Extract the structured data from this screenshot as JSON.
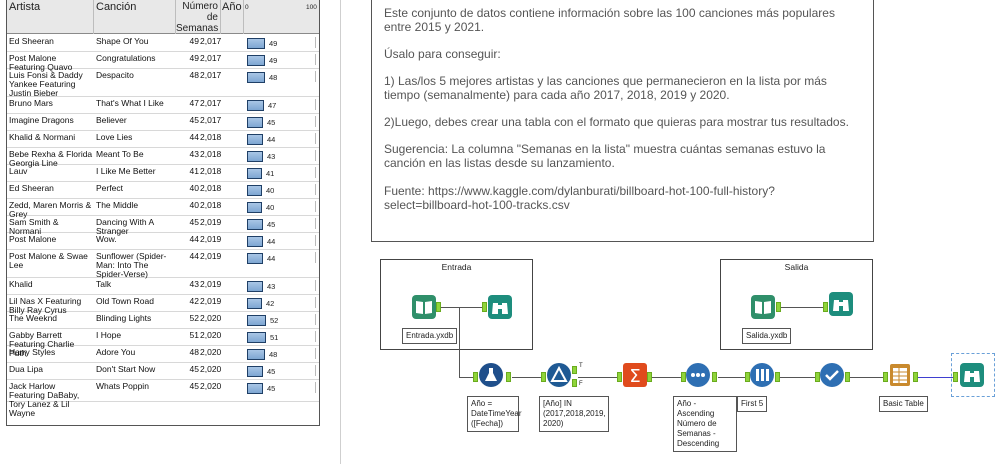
{
  "table": {
    "headers": {
      "artist": "Artista",
      "song": "Canción",
      "weeks": "Número de Semanas",
      "year": "Año",
      "axis_min": "0",
      "axis_max": "100"
    },
    "rows": [
      {
        "artist": "Ed Sheeran",
        "song": "Shape Of You",
        "weeks": "49",
        "year": "2,017",
        "bar": 49
      },
      {
        "artist": "Post Malone Featuring Quavo",
        "song": "Congratulations",
        "weeks": "49",
        "year": "2,017",
        "bar": 49
      },
      {
        "artist": "Luis Fonsi & Daddy Yankee Featuring Justin Bieber",
        "song": "Despacito",
        "weeks": "48",
        "year": "2,017",
        "bar": 48
      },
      {
        "artist": "Bruno Mars",
        "song": "That's What I Like",
        "weeks": "47",
        "year": "2,017",
        "bar": 47
      },
      {
        "artist": "Imagine Dragons",
        "song": "Believer",
        "weeks": "45",
        "year": "2,017",
        "bar": 45
      },
      {
        "artist": "Khalid & Normani",
        "song": "Love Lies",
        "weeks": "44",
        "year": "2,018",
        "bar": 44
      },
      {
        "artist": "Bebe Rexha & Florida Georgia Line",
        "song": "Meant To Be",
        "weeks": "43",
        "year": "2,018",
        "bar": 43
      },
      {
        "artist": "Lauv",
        "song": "I Like Me Better",
        "weeks": "41",
        "year": "2,018",
        "bar": 41
      },
      {
        "artist": "Ed Sheeran",
        "song": "Perfect",
        "weeks": "40",
        "year": "2,018",
        "bar": 40
      },
      {
        "artist": "Zedd, Maren Morris & Grey",
        "song": "The Middle",
        "weeks": "40",
        "year": "2,018",
        "bar": 40
      },
      {
        "artist": "Sam Smith & Normani",
        "song": "Dancing With A Stranger",
        "weeks": "45",
        "year": "2,019",
        "bar": 45
      },
      {
        "artist": "Post Malone",
        "song": "Wow.",
        "weeks": "44",
        "year": "2,019",
        "bar": 44
      },
      {
        "artist": "Post Malone & Swae Lee",
        "song": "Sunflower (Spider-Man: Into The Spider-Verse)",
        "weeks": "44",
        "year": "2,019",
        "bar": 44
      },
      {
        "artist": "Khalid",
        "song": "Talk",
        "weeks": "43",
        "year": "2,019",
        "bar": 43
      },
      {
        "artist": "Lil Nas X Featuring Billy Ray Cyrus",
        "song": "Old Town Road",
        "weeks": "42",
        "year": "2,019",
        "bar": 42
      },
      {
        "artist": "The Weeknd",
        "song": "Blinding Lights",
        "weeks": "52",
        "year": "2,020",
        "bar": 52
      },
      {
        "artist": "Gabby Barrett Featuring Charlie Puth",
        "song": "I Hope",
        "weeks": "51",
        "year": "2,020",
        "bar": 51
      },
      {
        "artist": "Harry Styles",
        "song": "Adore You",
        "weeks": "48",
        "year": "2,020",
        "bar": 48
      },
      {
        "artist": "Dua Lipa",
        "song": "Don't Start Now",
        "weeks": "45",
        "year": "2,020",
        "bar": 45
      },
      {
        "artist": "Jack Harlow Featuring DaBaby, Tory Lanez & Lil Wayne",
        "song": "Whats Poppin",
        "weeks": "45",
        "year": "2,020",
        "bar": 45
      }
    ]
  },
  "comment": {
    "p1": "Este conjunto de datos contiene información sobre las 100 canciones más populares entre 2015 y 2021.",
    "p2": "Úsalo para conseguir:",
    "p3": "1) Las/los 5 mejores artistas y las canciones que permanecieron en la lista por más tiempo (semanalmente) para cada año 2017, 2018, 2019 y 2020.",
    "p4": "2)Luego, debes crear una tabla con el formato que quieras para mostrar tus resultados.",
    "p5": "Sugerencia: La columna \"Semanas en la lista\" muestra cuántas semanas estuvo la canción en las listas desde su lanzamiento.",
    "p6": "Fuente: https://www.kaggle.com/dylanburati/billboard-hot-100-full-history?select=billboard-hot-100-tracks.csv"
  },
  "workflow": {
    "container_in": "Entrada",
    "container_out": "Salida",
    "input_label": "Entrada.yxdb",
    "output_label": "Salida.yxdb",
    "formula_label": "Año = DateTimeYear ([Fecha])",
    "filter_label": "[Año] IN (2017,2018,2019, 2020)",
    "sort_label": "Año - Ascending Número de Semanas - Descending",
    "sample_label": "First 5",
    "basic_table_label": "Basic Table",
    "filter_true": "T",
    "filter_false": "F"
  },
  "colors": {
    "input_tool": "#2f8f6a",
    "browse_tool": "#1d8d7d",
    "formula_tool": "#1f4f8b",
    "filter_tool": "#1f5a94",
    "summarize_tool": "#e04b1d",
    "sort_tool": "#2e6fb3",
    "sample_tool": "#2e6fb3",
    "unique_tool": "#2e6fb3",
    "table_tool": "#c98a2e",
    "bar_fill": "#8fb3dc",
    "anchor": "#8fd43a"
  }
}
